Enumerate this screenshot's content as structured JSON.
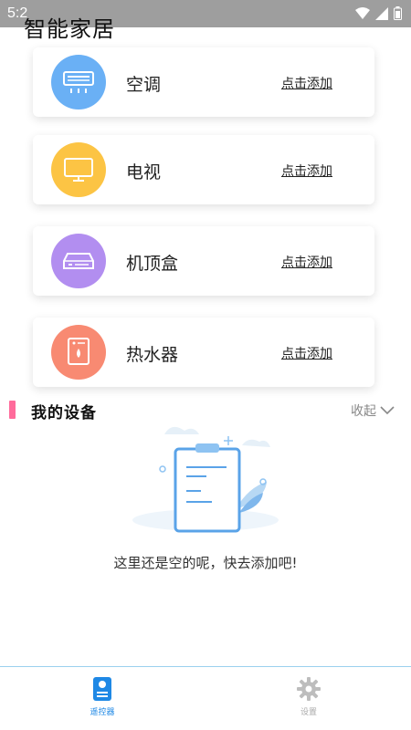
{
  "status": {
    "time": "5:2"
  },
  "header": {
    "title": "智能家居"
  },
  "devices": [
    {
      "name": "空调",
      "action": "点击添加",
      "icon": "air-conditioner-icon",
      "color": "#6ab0f5"
    },
    {
      "name": "电视",
      "action": "点击添加",
      "icon": "tv-icon",
      "color": "#fcc444"
    },
    {
      "name": "机顶盒",
      "action": "点击添加",
      "icon": "set-top-box-icon",
      "color": "#b28ef0"
    },
    {
      "name": "热水器",
      "action": "点击添加",
      "icon": "water-heater-icon",
      "color": "#f88a72"
    }
  ],
  "my_devices": {
    "title": "我的设备",
    "collapse_label": "收起",
    "empty_text": "这里还是空的呢，快去添加吧!"
  },
  "bottom_nav": [
    {
      "label": "遥控器",
      "icon": "remote-icon",
      "active": true
    },
    {
      "label": "设置",
      "icon": "gear-icon",
      "active": false
    }
  ],
  "colors": {
    "accent": "#1e88e5",
    "section_bar": "#ff6b9b"
  }
}
